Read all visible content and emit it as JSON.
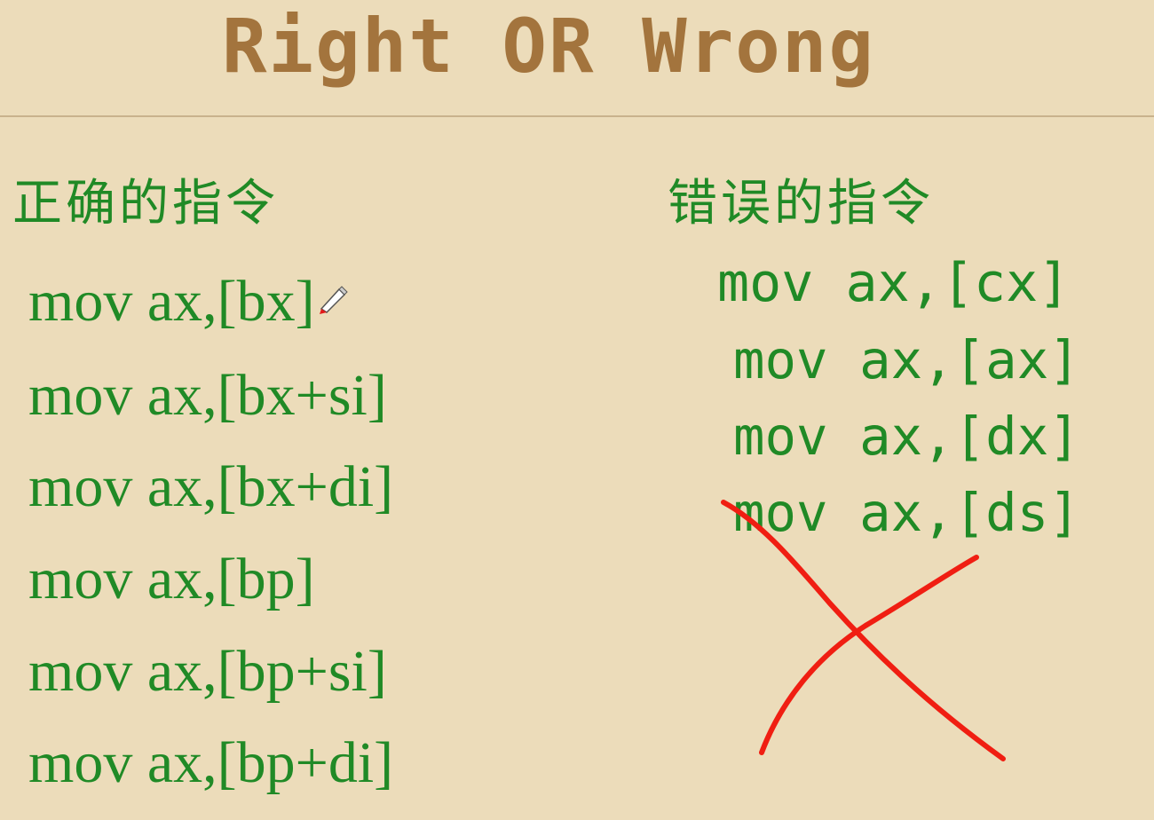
{
  "slide": {
    "title": "Right OR Wrong",
    "left_heading": "正确的指令",
    "right_heading": "错误的指令",
    "correct_instructions": [
      "mov ax,[bx]",
      "mov ax,[bx+si]",
      "mov ax,[bx+di]",
      "mov ax,[bp]",
      "mov ax,[bp+si]",
      "mov ax,[bp+di]"
    ],
    "wrong_instructions": [
      "mov ax,[cx]",
      "mov ax,[ax]",
      "mov ax,[dx]",
      "mov ax,[ds]"
    ]
  },
  "annotation": {
    "mark_icon": "red-cross-mark-icon",
    "mark_color": "#f01e12",
    "cursor_icon": "pen-cursor-icon"
  },
  "colors": {
    "background": "#ecdcba",
    "title": "#a3743d",
    "text": "#208a26",
    "divider": "#c9b28d"
  }
}
